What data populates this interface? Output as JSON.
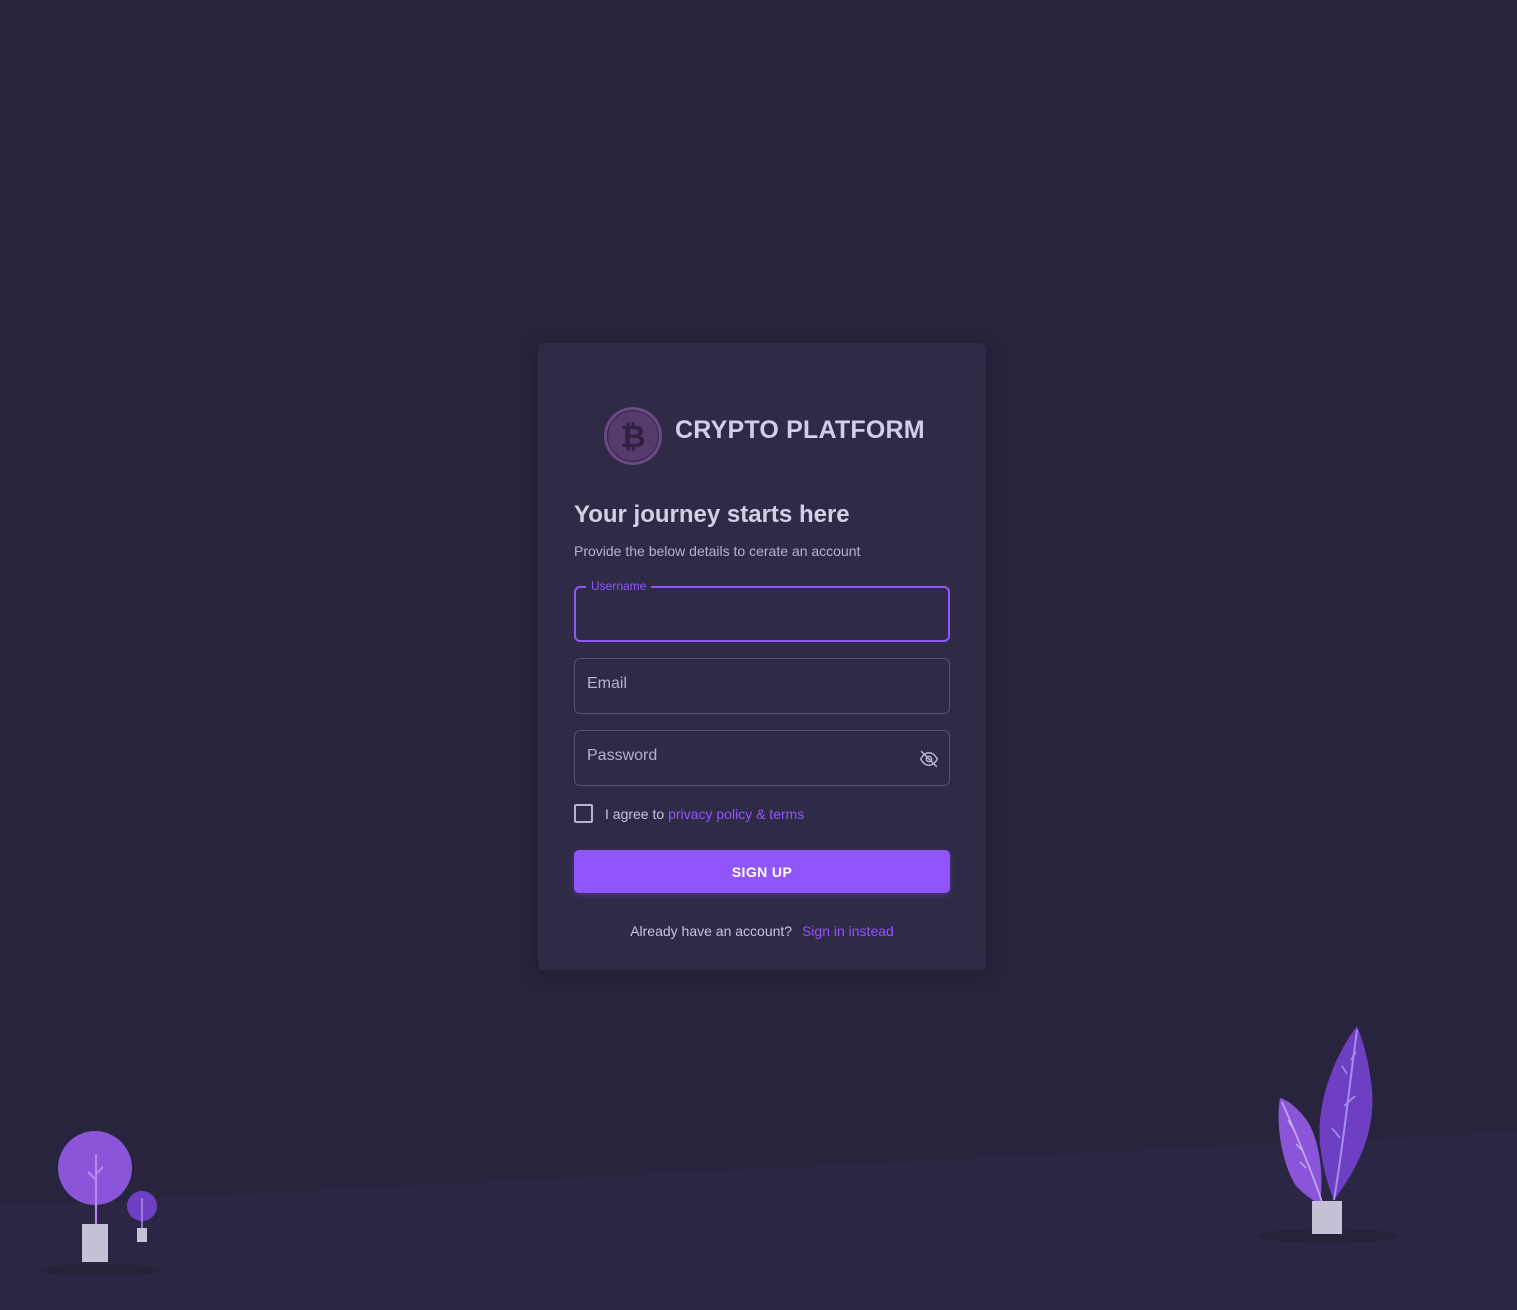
{
  "brand": {
    "name": "CRYPTO PLATFORM",
    "logo_icon": "bitcoin-coin-icon",
    "logo_color": "#6b4a85"
  },
  "form": {
    "headline": "Your journey starts here",
    "subline": "Provide the below details to cerate an account",
    "username": {
      "label": "Username",
      "value": ""
    },
    "email": {
      "label": "Email",
      "value": ""
    },
    "password": {
      "label": "Password",
      "value": "",
      "toggle_icon": "eye-off-icon"
    },
    "agree": {
      "prefix": "I agree to",
      "link": "privacy policy & terms",
      "checked": false
    },
    "submit_label": "SIGN UP",
    "signin_prompt": "Already have an account?",
    "signin_link": "Sign in instead"
  },
  "theme": {
    "background": "#28243d",
    "card": "#2f2b47",
    "primary": "#9155fd",
    "text": "#d3cfe6"
  },
  "decorations": {
    "left": "tree-illustration",
    "right": "plant-illustration"
  }
}
